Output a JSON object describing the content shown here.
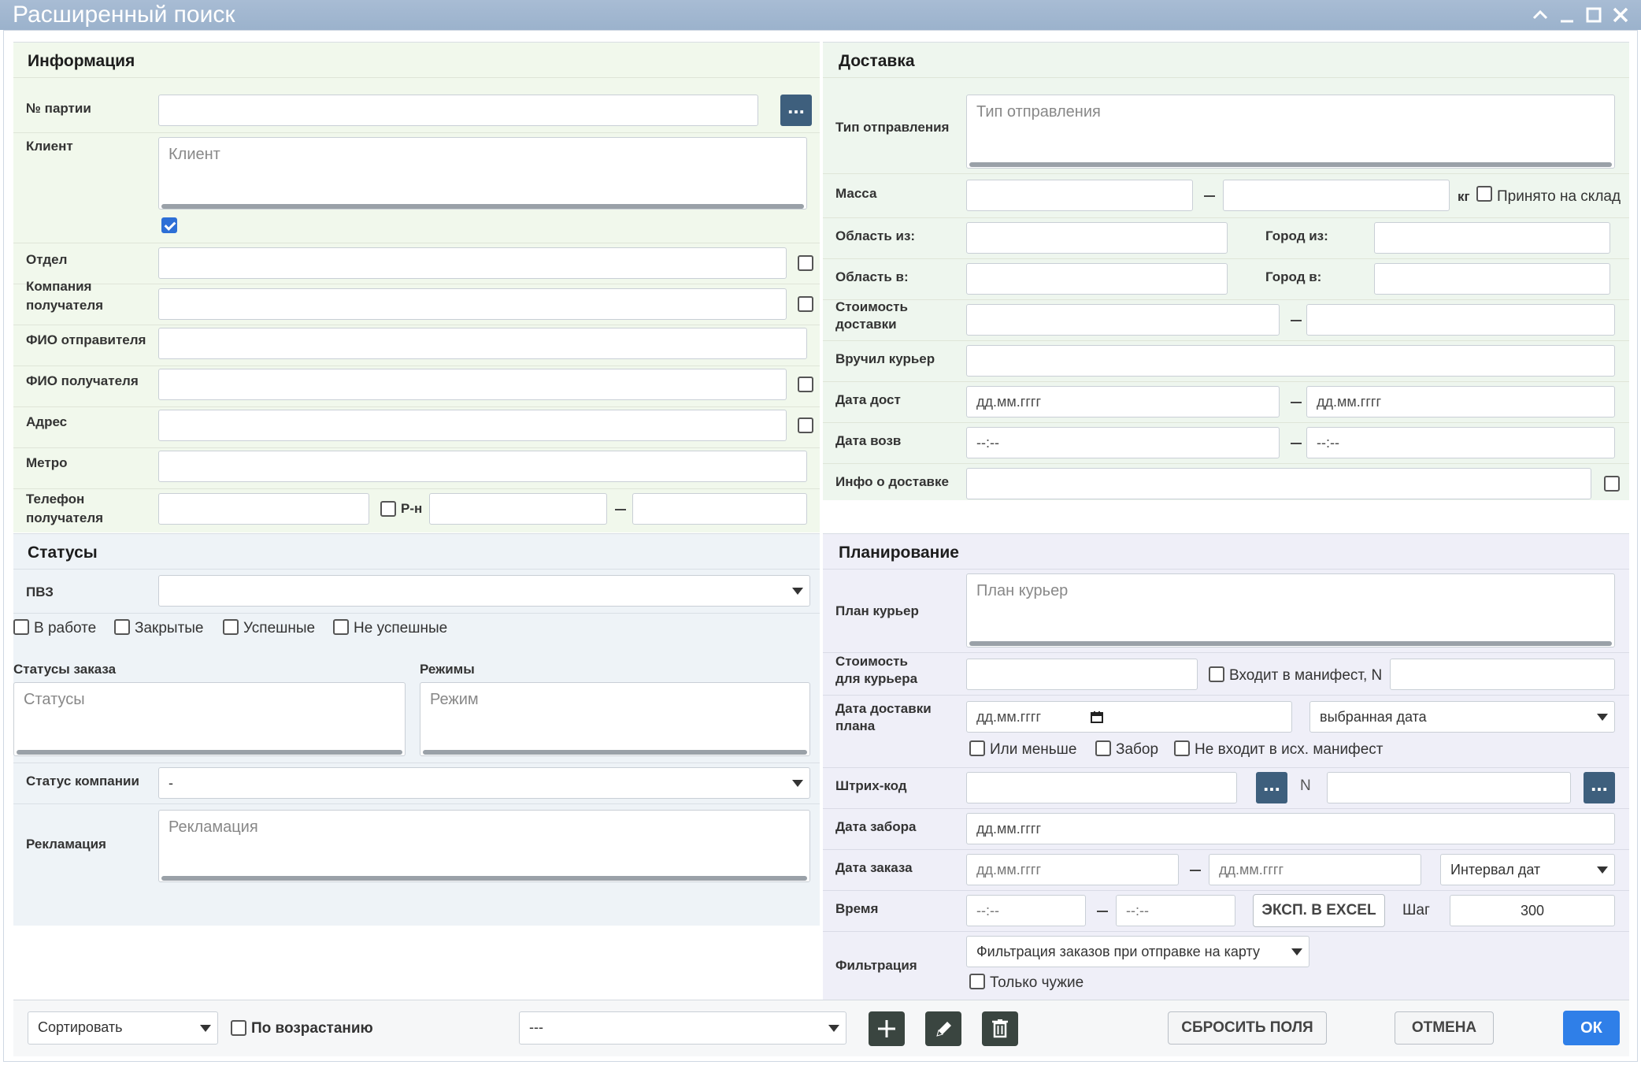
{
  "window": {
    "title": "Расширенный поиск"
  },
  "info": {
    "title": "Информация",
    "batch_label": "№ партии",
    "client_label": "Клиент",
    "client_placeholder": "Клиент",
    "dept_label": "Отдел",
    "company_label_1": "Компания",
    "company_label_2": "получателя",
    "sender_label": "ФИО отправителя",
    "recipient_label": "ФИО получателя",
    "address_label": "Адрес",
    "metro_label": "Метро",
    "phone_label_1": "Телефон",
    "phone_label_2": "получателя",
    "district_label": "Р-н"
  },
  "delivery": {
    "title": "Доставка",
    "type_label": "Тип отправления",
    "type_placeholder": "Тип отправления",
    "mass_label": "Масса",
    "kg_label": "кг",
    "accepted_label": "Принято на склад",
    "region_from_label": "Область из:",
    "city_from_label": "Город из:",
    "region_to_label": "Область в:",
    "city_to_label": "Город в:",
    "cost_label_1": "Стоимость",
    "cost_label_2": "доставки",
    "courier_label": "Вручил курьер",
    "date_label": "Дата дост",
    "date_placeholder": "дд.мм.гггг",
    "return_label": "Дата возв",
    "time_placeholder": "--:--",
    "info_label": "Инфо о доставке"
  },
  "statuses": {
    "title": "Статусы",
    "pvz_label": "ПВЗ",
    "in_work": "В работе",
    "closed": "Закрытые",
    "success": "Успешные",
    "failed": "Не успешные",
    "order_status_label": "Статусы заказа",
    "order_status_placeholder": "Статусы",
    "modes_label": "Режимы",
    "modes_placeholder": "Режим",
    "company_status_label": "Статус компании",
    "company_status_value": "-",
    "claim_label": "Рекламация",
    "claim_placeholder": "Рекламация"
  },
  "planning": {
    "title": "Планирование",
    "plan_courier_label": "План курьер",
    "plan_courier_placeholder": "План курьер",
    "courier_cost_label_1": "Стоимость",
    "courier_cost_label_2": "для курьера",
    "manifest_label": "Входит в манифест, N",
    "plan_date_label_1": "Дата доставки",
    "plan_date_label_2": "плана",
    "plan_date_placeholder": "дд.мм.гггг",
    "date_mode_value": "выбранная дата",
    "or_less": "Или меньше",
    "pickup": "Забор",
    "not_in_manifest": "Не входит в исх. манифест",
    "barcode_label": "Штрих-код",
    "n_label": "N",
    "pickup_date_label": "Дата забора",
    "pickup_date_placeholder": "дд.мм.гггг",
    "order_date_label": "Дата заказа",
    "order_date_placeholder": "дд.мм.гггг",
    "interval_value": "Интервал дат",
    "time_label": "Время",
    "time_placeholder": "--:--",
    "excel_button": "ЭКСП. В EXCEL",
    "step_label": "Шаг",
    "step_value": "300",
    "filter_label": "Фильтрация",
    "filter_value": "Фильтрация заказов при отправке на карту",
    "only_foreign": "Только чужие"
  },
  "footer": {
    "sort_value": "Сортировать",
    "ascending": "По возрастанию",
    "preset_value": "---",
    "reset_button": "СБРОСИТЬ ПОЛЯ",
    "cancel_button": "ОТМЕНА",
    "ok_button": "ОК"
  }
}
